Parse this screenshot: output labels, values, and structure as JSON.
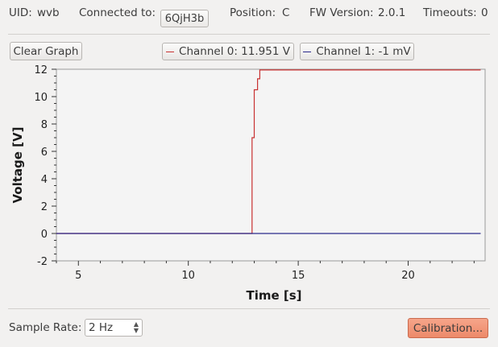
{
  "header": {
    "uid_label": "UID:",
    "uid_value": "wvb",
    "connected_label": "Connected to:",
    "connected_value": "6QjH3b",
    "position_label": "Position:",
    "position_value": "C",
    "fw_label": "FW Version:",
    "fw_value": "2.0.1",
    "timeouts_label": "Timeouts:",
    "timeouts_value": "0"
  },
  "toolbar": {
    "clear_label": "Clear Graph",
    "channel0_label": "Channel 0: 11.951 V",
    "channel1_label": "Channel 1: -1 mV",
    "channel0_color": "#c83232",
    "channel1_color": "#2a2a8c"
  },
  "chart_data": {
    "type": "line",
    "xlabel": "Time [s]",
    "ylabel": "Voltage [V]",
    "xlim": [
      4,
      23.5
    ],
    "ylim": [
      -2,
      12
    ],
    "x_ticks": [
      5,
      10,
      15,
      20
    ],
    "y_ticks": [
      -2,
      0,
      2,
      4,
      6,
      8,
      10,
      12
    ],
    "series": [
      {
        "name": "Channel 0",
        "color": "#c83232",
        "points": [
          [
            4,
            0
          ],
          [
            12.9,
            0
          ],
          [
            12.9,
            7
          ],
          [
            13.0,
            7
          ],
          [
            13.0,
            10.5
          ],
          [
            13.15,
            10.5
          ],
          [
            13.15,
            11.3
          ],
          [
            13.25,
            11.3
          ],
          [
            13.25,
            11.95
          ],
          [
            23.3,
            11.95
          ]
        ]
      },
      {
        "name": "Channel 1",
        "color": "#2a2a8c",
        "points": [
          [
            4,
            0
          ],
          [
            23.3,
            0
          ]
        ]
      }
    ]
  },
  "footer": {
    "sample_rate_label": "Sample Rate:",
    "sample_rate_value": "2 Hz",
    "calibration_label": "Calibration..."
  }
}
